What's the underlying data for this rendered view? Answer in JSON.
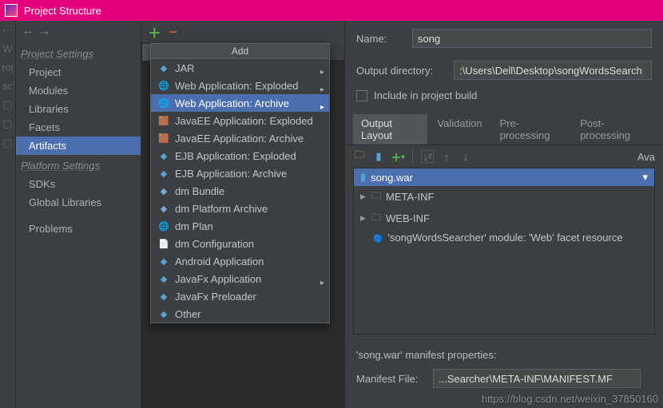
{
  "titlebar": {
    "title": "Project Structure"
  },
  "sidebar": {
    "section1": "Project Settings",
    "section2": "Platform Settings",
    "items1": [
      "Project",
      "Modules",
      "Libraries",
      "Facets",
      "Artifacts"
    ],
    "items2": [
      "SDKs",
      "Global Libraries"
    ],
    "items3": [
      "Problems"
    ]
  },
  "add_popup": {
    "header": "Add",
    "items": [
      {
        "label": "JAR",
        "icon": "diamond",
        "submenu": true
      },
      {
        "label": "Web Application: Exploded",
        "icon": "globe",
        "submenu": true
      },
      {
        "label": "Web Application: Archive",
        "icon": "globe",
        "submenu": true,
        "selected": true
      },
      {
        "label": "JavaEE Application: Exploded",
        "icon": "box",
        "submenu": false
      },
      {
        "label": "JavaEE Application: Archive",
        "icon": "box",
        "submenu": false
      },
      {
        "label": "EJB Application: Exploded",
        "icon": "diamond",
        "submenu": false
      },
      {
        "label": "EJB Application: Archive",
        "icon": "diamond",
        "submenu": false
      },
      {
        "label": "dm Bundle",
        "icon": "dm",
        "submenu": false
      },
      {
        "label": "dm Platform Archive",
        "icon": "dm",
        "submenu": false
      },
      {
        "label": "dm Plan",
        "icon": "globe",
        "submenu": false
      },
      {
        "label": "dm Configuration",
        "icon": "cfg",
        "submenu": false
      },
      {
        "label": "Android Application",
        "icon": "diamond",
        "submenu": false
      },
      {
        "label": "JavaFx Application",
        "icon": "diamond",
        "submenu": true
      },
      {
        "label": "JavaFx Preloader",
        "icon": "diamond",
        "submenu": false
      },
      {
        "label": "Other",
        "icon": "diamond",
        "submenu": false
      }
    ]
  },
  "form": {
    "name_label": "Name:",
    "name_value": "song",
    "outdir_label": "Output directory:",
    "outdir_value": ":\\Users\\Dell\\Desktop\\songWordsSearch",
    "include_label": "Include in project build"
  },
  "tabs": [
    "Output Layout",
    "Validation",
    "Pre-processing",
    "Post-processing"
  ],
  "toolbar_right": {
    "ava": "Ava"
  },
  "tree": {
    "root": "song.war",
    "children": [
      {
        "label": "META-INF",
        "type": "folder"
      },
      {
        "label": "WEB-INF",
        "type": "folder"
      },
      {
        "label": "'songWordsSearcher' module: 'Web' facet resource",
        "type": "module"
      }
    ]
  },
  "manifest": {
    "header": "'song.war' manifest properties:",
    "file_label": "Manifest File:",
    "file_value": "...Searcher\\META-INF\\MANIFEST.MF"
  },
  "watermark": "https://blog.csdn.net/weixin_37850160"
}
